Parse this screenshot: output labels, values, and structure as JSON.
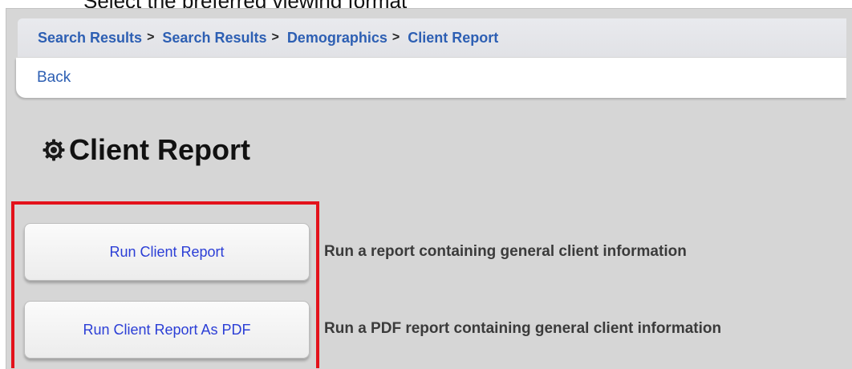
{
  "doc_caption": "Select the preferred viewing format",
  "breadcrumb": {
    "items": [
      {
        "label": "Search Results",
        "separator": ">"
      },
      {
        "label": "Search Results",
        "separator": ">"
      },
      {
        "label": "Demographics",
        "separator": ">"
      },
      {
        "label": "Client Report",
        "separator": ""
      }
    ]
  },
  "nav": {
    "back_label": "Back"
  },
  "page": {
    "title": "Client Report",
    "title_icon": "gear-icon"
  },
  "actions": [
    {
      "button_label": "Run Client Report",
      "description": "Run a report containing general client information"
    },
    {
      "button_label": "Run Client Report As PDF",
      "description": "Run a PDF report containing general client information"
    }
  ],
  "colors": {
    "link": "#2d5fb3",
    "button_text": "#2b3ed6",
    "highlight": "#e3121b",
    "panel_bg": "#d6d6d6"
  }
}
